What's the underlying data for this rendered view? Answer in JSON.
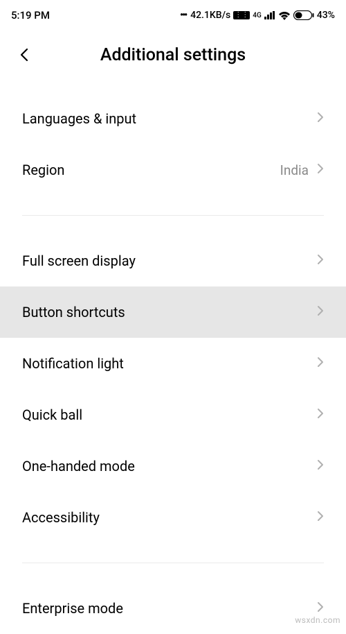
{
  "statusBar": {
    "time": "5:19 PM",
    "netSpeed": "42.1KB/s",
    "simLabel": "⋮⋮",
    "networkType": "4G",
    "battery": "43%"
  },
  "header": {
    "title": "Additional settings"
  },
  "items": {
    "languagesInput": {
      "label": "Languages & input"
    },
    "region": {
      "label": "Region",
      "value": "India"
    },
    "fullScreen": {
      "label": "Full screen display"
    },
    "buttonShortcuts": {
      "label": "Button shortcuts"
    },
    "notificationLight": {
      "label": "Notification light"
    },
    "quickBall": {
      "label": "Quick ball"
    },
    "oneHanded": {
      "label": "One-handed mode"
    },
    "accessibility": {
      "label": "Accessibility"
    },
    "enterpriseMode": {
      "label": "Enterprise mode"
    }
  },
  "watermark": "wsxdn.com"
}
